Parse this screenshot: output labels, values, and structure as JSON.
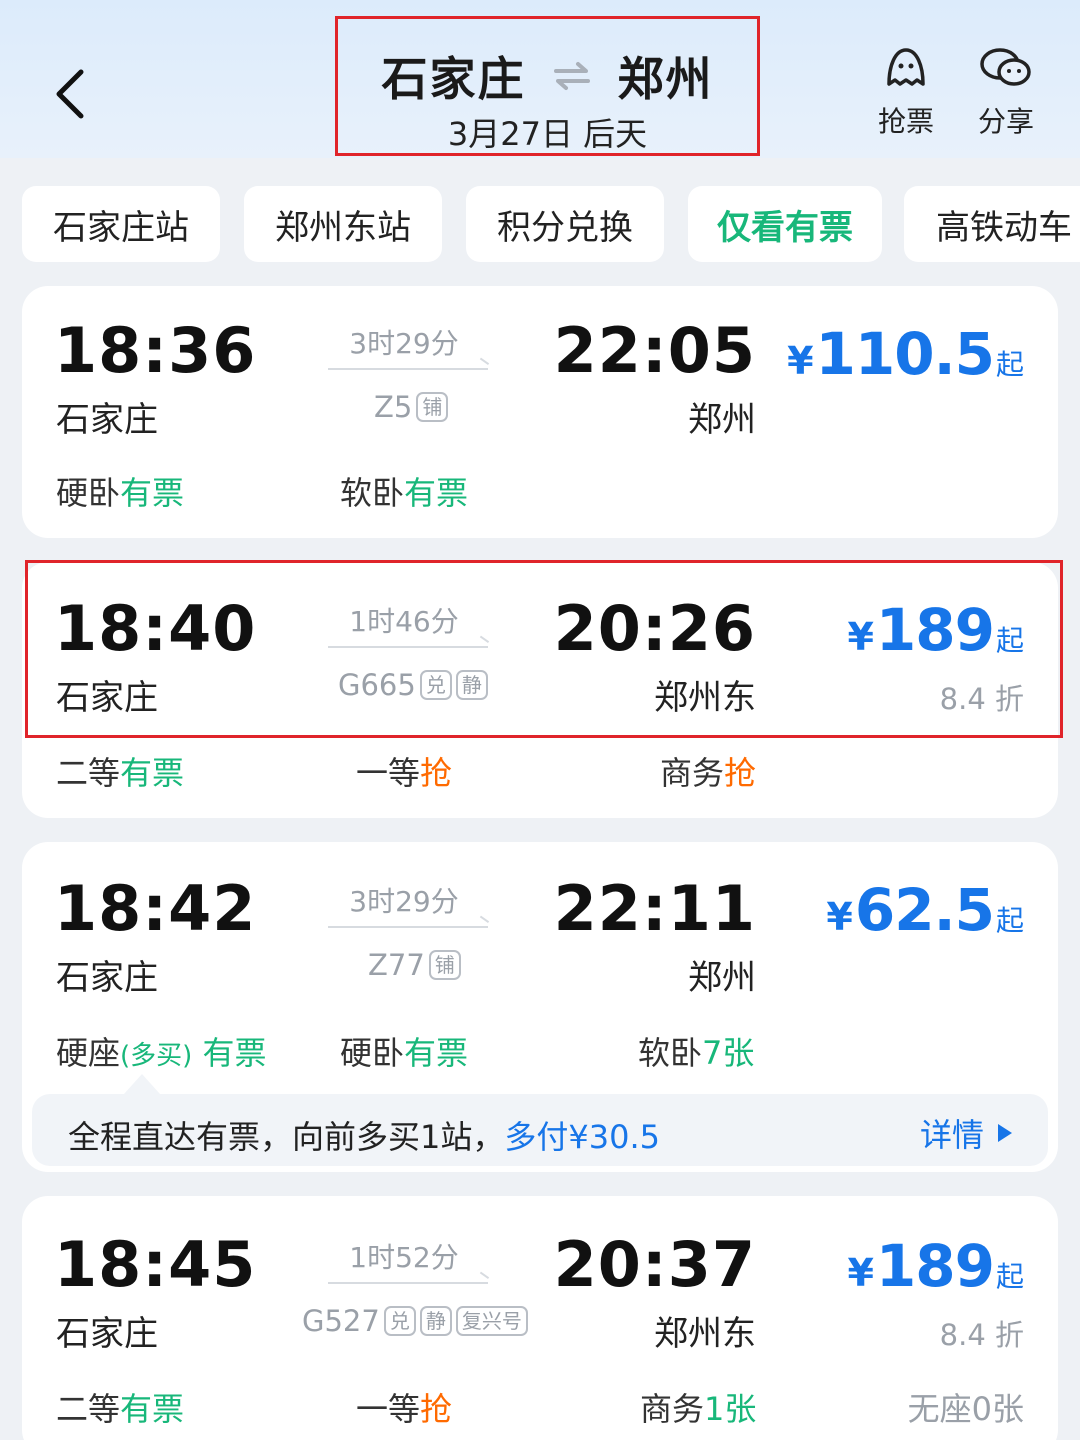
{
  "header": {
    "from": "石家庄",
    "to": "郑州",
    "date": "3月27日 后天",
    "grab_label": "抢票",
    "share_label": "分享"
  },
  "filters": [
    "石家庄站",
    "郑州东站",
    "积分兑换",
    "仅看有票",
    "高铁动车"
  ],
  "active_filter": "仅看有票",
  "colors": {
    "accent_blue": "#1775e8",
    "green": "#18b77a",
    "orange": "#ff6a00",
    "highlight_red": "#e0242a"
  },
  "trains": [
    {
      "depart": "18:36",
      "from": "石家庄",
      "duration": "3时29分",
      "number": "Z5",
      "tags": [
        "铺"
      ],
      "arrive": "22:05",
      "to": "郑州",
      "price_currency": "¥",
      "price": "110.5",
      "price_suffix": "起",
      "seats": [
        {
          "name": "硬卧",
          "status": "有票"
        },
        {
          "name": "软卧",
          "status": "有票"
        }
      ]
    },
    {
      "depart": "18:40",
      "from": "石家庄",
      "duration": "1时46分",
      "number": "G665",
      "tags": [
        "兑",
        "静"
      ],
      "arrive": "20:26",
      "to": "郑州东",
      "price_currency": "¥",
      "price": "189",
      "price_suffix": "起",
      "discount": "8.4 折",
      "seats": [
        {
          "name": "二等",
          "status": "有票"
        },
        {
          "name": "一等",
          "status": "抢"
        },
        {
          "name": "商务",
          "status": "抢"
        }
      ]
    },
    {
      "depart": "18:42",
      "from": "石家庄",
      "duration": "3时29分",
      "number": "Z77",
      "tags": [
        "铺"
      ],
      "arrive": "22:11",
      "to": "郑州",
      "price_currency": "¥",
      "price": "62.5",
      "price_suffix": "起",
      "seats": [
        {
          "name": "硬座",
          "note": "(多买)",
          "status": "有票"
        },
        {
          "name": "硬卧",
          "status": "有票"
        },
        {
          "name": "软卧",
          "status": "7张"
        }
      ],
      "hint": {
        "text": "全程直达有票，向前多买1站，",
        "extra": "多付¥30.5",
        "detail": "详情"
      }
    },
    {
      "depart": "18:45",
      "from": "石家庄",
      "duration": "1时52分",
      "number": "G527",
      "tags": [
        "兑",
        "静",
        "复兴号"
      ],
      "arrive": "20:37",
      "to": "郑州东",
      "price_currency": "¥",
      "price": "189",
      "price_suffix": "起",
      "discount": "8.4 折",
      "seats": [
        {
          "name": "二等",
          "status": "有票"
        },
        {
          "name": "一等",
          "status": "抢"
        },
        {
          "name": "商务",
          "status": "1张"
        },
        {
          "name": "无座",
          "status": "0张"
        }
      ]
    }
  ]
}
